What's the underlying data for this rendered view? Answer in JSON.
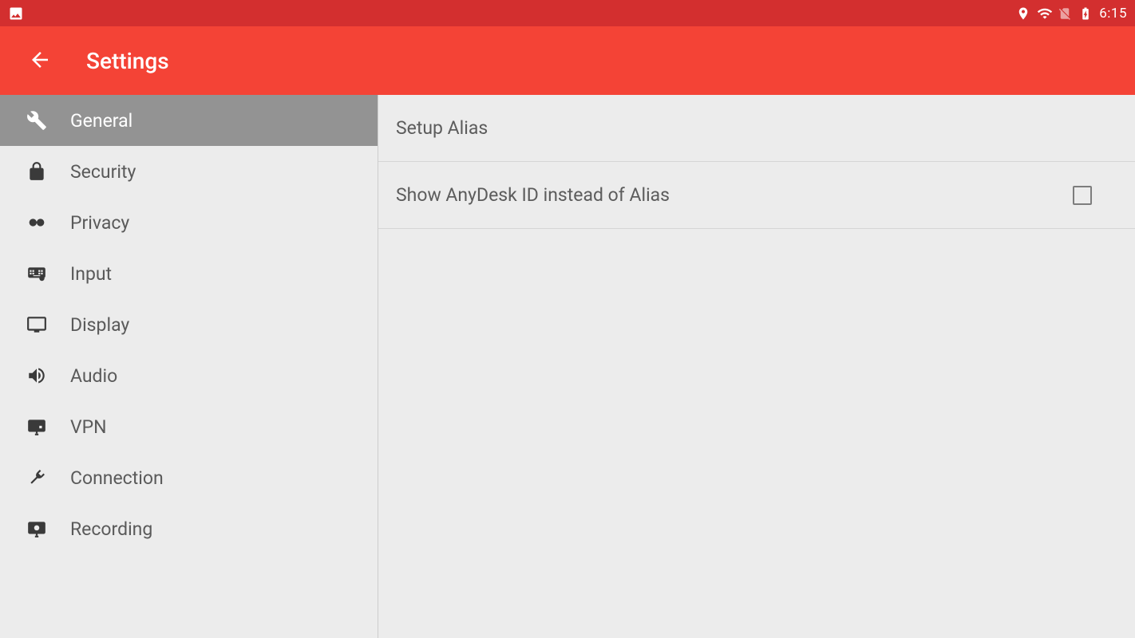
{
  "status_bar": {
    "time": "6:15"
  },
  "app_bar": {
    "title": "Settings"
  },
  "sidebar": {
    "items": [
      {
        "label": "General"
      },
      {
        "label": "Security"
      },
      {
        "label": "Privacy"
      },
      {
        "label": "Input"
      },
      {
        "label": "Display"
      },
      {
        "label": "Audio"
      },
      {
        "label": "VPN"
      },
      {
        "label": "Connection"
      },
      {
        "label": "Recording"
      }
    ]
  },
  "content": {
    "rows": [
      {
        "label": "Setup Alias"
      },
      {
        "label": "Show AnyDesk ID instead of Alias"
      }
    ]
  }
}
